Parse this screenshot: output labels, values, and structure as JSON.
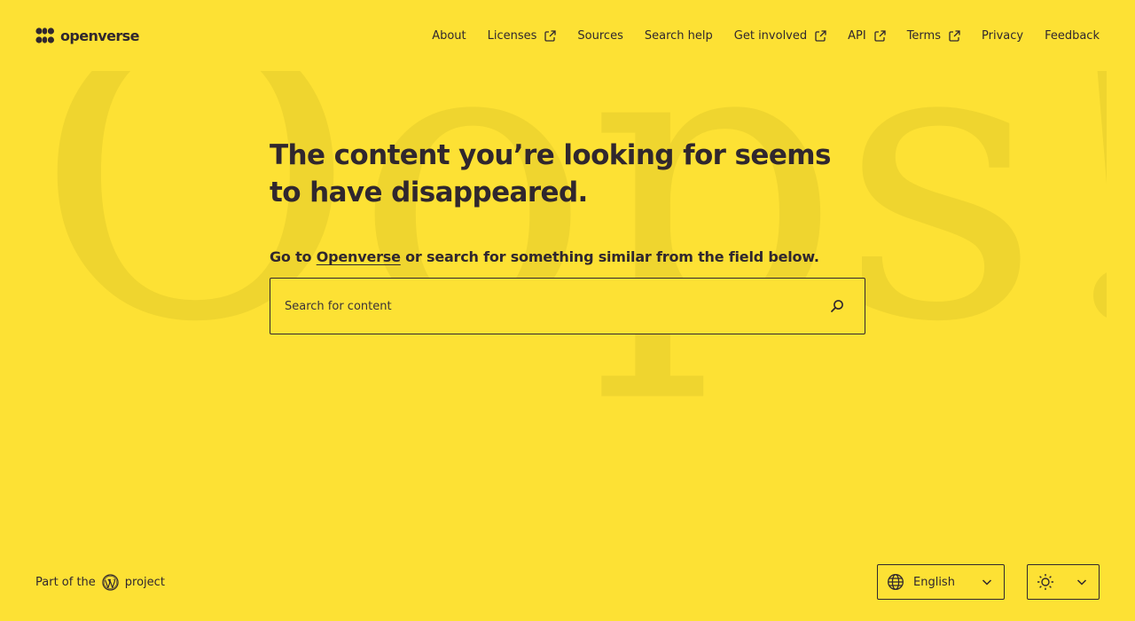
{
  "background_text": "Oops!",
  "header": {
    "logo_text": "openverse",
    "nav": [
      {
        "label": "About",
        "external": false
      },
      {
        "label": "Licenses",
        "external": true
      },
      {
        "label": "Sources",
        "external": false
      },
      {
        "label": "Search help",
        "external": false
      },
      {
        "label": "Get involved",
        "external": true
      },
      {
        "label": "API",
        "external": true
      },
      {
        "label": "Terms",
        "external": true
      },
      {
        "label": "Privacy",
        "external": false
      },
      {
        "label": "Feedback",
        "external": false
      }
    ]
  },
  "main": {
    "headline": "The content you’re looking for seems to have disappeared.",
    "sub_prefix": "Go to ",
    "sub_link": "Openverse",
    "sub_suffix": " or search for something similar from the field below.",
    "search_placeholder": "Search for content"
  },
  "footer": {
    "part_of": "Part of the",
    "project": "project",
    "language": "English"
  },
  "icons": {
    "logo": "openverse-logo-icon",
    "external": "external-link-icon",
    "search": "search-icon",
    "wordpress": "wordpress-icon",
    "globe": "globe-icon",
    "sun": "sun-icon",
    "chevron": "chevron-down-icon"
  },
  "colors": {
    "background": "#fde134",
    "text": "#30272e",
    "watermark": "#efd52f"
  }
}
